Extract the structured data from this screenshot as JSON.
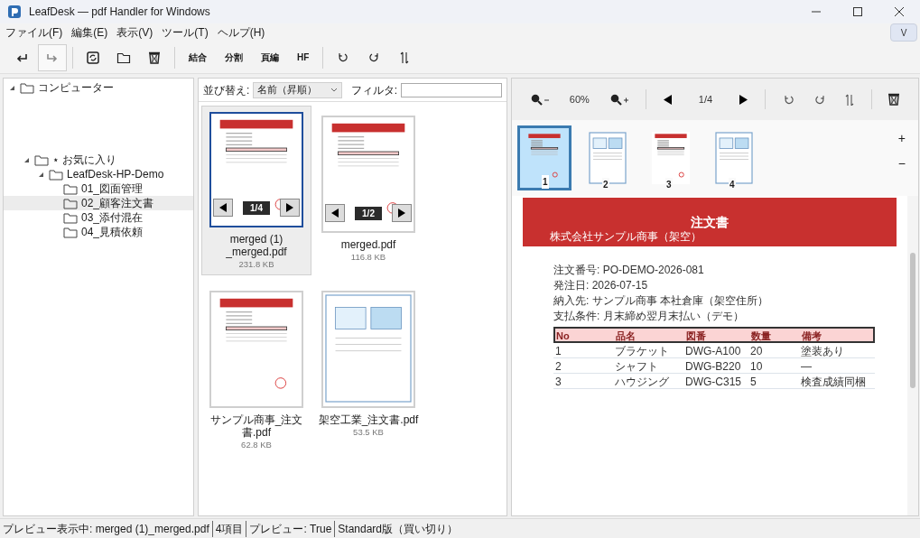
{
  "window": {
    "title": "LeafDesk — pdf Handler for Windows",
    "collapse_button": "V"
  },
  "menu": [
    "ファイル(F)",
    "編集(E)",
    "表示(V)",
    "ツール(T)",
    "ヘルプ(H)"
  ],
  "toolbar": [
    {
      "kind": "undo",
      "pressed": false
    },
    {
      "kind": "redo",
      "pressed": true
    },
    {
      "kind": "separator"
    },
    {
      "kind": "refresh",
      "pressed": false
    },
    {
      "kind": "folder",
      "pressed": false
    },
    {
      "kind": "trash",
      "pressed": false
    },
    {
      "kind": "separator"
    },
    {
      "kind": "text",
      "label": "結合"
    },
    {
      "kind": "text",
      "label": "分割"
    },
    {
      "kind": "text",
      "label": "頁編"
    },
    {
      "kind": "text",
      "label": "HF"
    },
    {
      "kind": "separator"
    },
    {
      "kind": "rotate-left",
      "pressed": false
    },
    {
      "kind": "rotate-right",
      "pressed": false
    },
    {
      "kind": "swap",
      "pressed": false
    }
  ],
  "tree": [
    {
      "label": "コンピューター",
      "expanded": true,
      "selected": false
    },
    {
      "label": "⋆ お気に入り",
      "expanded": true,
      "selected": false,
      "children": [
        {
          "label": "LeafDesk-HP-Demo",
          "expanded": true,
          "selected": false,
          "children": [
            {
              "label": "01_図面管理",
              "selected": false
            },
            {
              "label": "02_顧客注文書",
              "selected": true
            },
            {
              "label": "03_添付混在",
              "selected": false
            },
            {
              "label": "04_見積依頼",
              "selected": false
            }
          ]
        }
      ]
    }
  ],
  "file_list": {
    "sort_label": "並び替え:",
    "sort_value": "名前（昇順）",
    "filter_label": "フィルタ:",
    "files": [
      {
        "name": "merged (1)\n_merged.pdf",
        "size": "231.8 KB",
        "selected": true,
        "kind": "red",
        "page_indicator": "1/4"
      },
      {
        "name": "merged.pdf",
        "size": "116.8 KB",
        "selected": false,
        "kind": "red",
        "page_indicator": "1/2"
      },
      {
        "name": "サンプル商事_注文書.pdf",
        "size": "62.8 KB",
        "selected": false,
        "kind": "red"
      },
      {
        "name": "架空工業_注文書.pdf",
        "size": "53.5 KB",
        "selected": false,
        "kind": "blue"
      }
    ]
  },
  "viewer": {
    "zoom": "60%",
    "page": "1/4",
    "zoom_in": "+",
    "zoom_out": "−",
    "thumbnails": [
      {
        "number": "1",
        "selected": true,
        "kind": "red"
      },
      {
        "number": "2",
        "selected": false,
        "kind": "blue"
      },
      {
        "number": "3",
        "selected": false,
        "kind": "red"
      },
      {
        "number": "4",
        "selected": false,
        "kind": "blue"
      }
    ],
    "document": {
      "title": "注文書",
      "company": "株式会社サンプル商事（架空）",
      "fields": [
        "注文番号: PO-DEMO-2026-081",
        "発注日: 2026-07-15",
        "納入先: サンプル商事 本社倉庫（架空住所）",
        "支払条件: 月末締め翌月末払い（デモ）"
      ],
      "columns": [
        "No",
        "品名",
        "図番",
        "数量",
        "備考"
      ],
      "rows": [
        [
          "1",
          "ブラケット",
          "DWG-A100",
          "20",
          "塗装あり"
        ],
        [
          "2",
          "シャフト",
          "DWG-B220",
          "10",
          "—"
        ],
        [
          "3",
          "ハウジング",
          "DWG-C315",
          "5",
          "検査成績同梱"
        ]
      ]
    }
  },
  "status_bar": [
    "プレビュー表示中: merged (1)_merged.pdf",
    "4項目",
    "プレビュー: True",
    "Standard版（買い切り）"
  ]
}
